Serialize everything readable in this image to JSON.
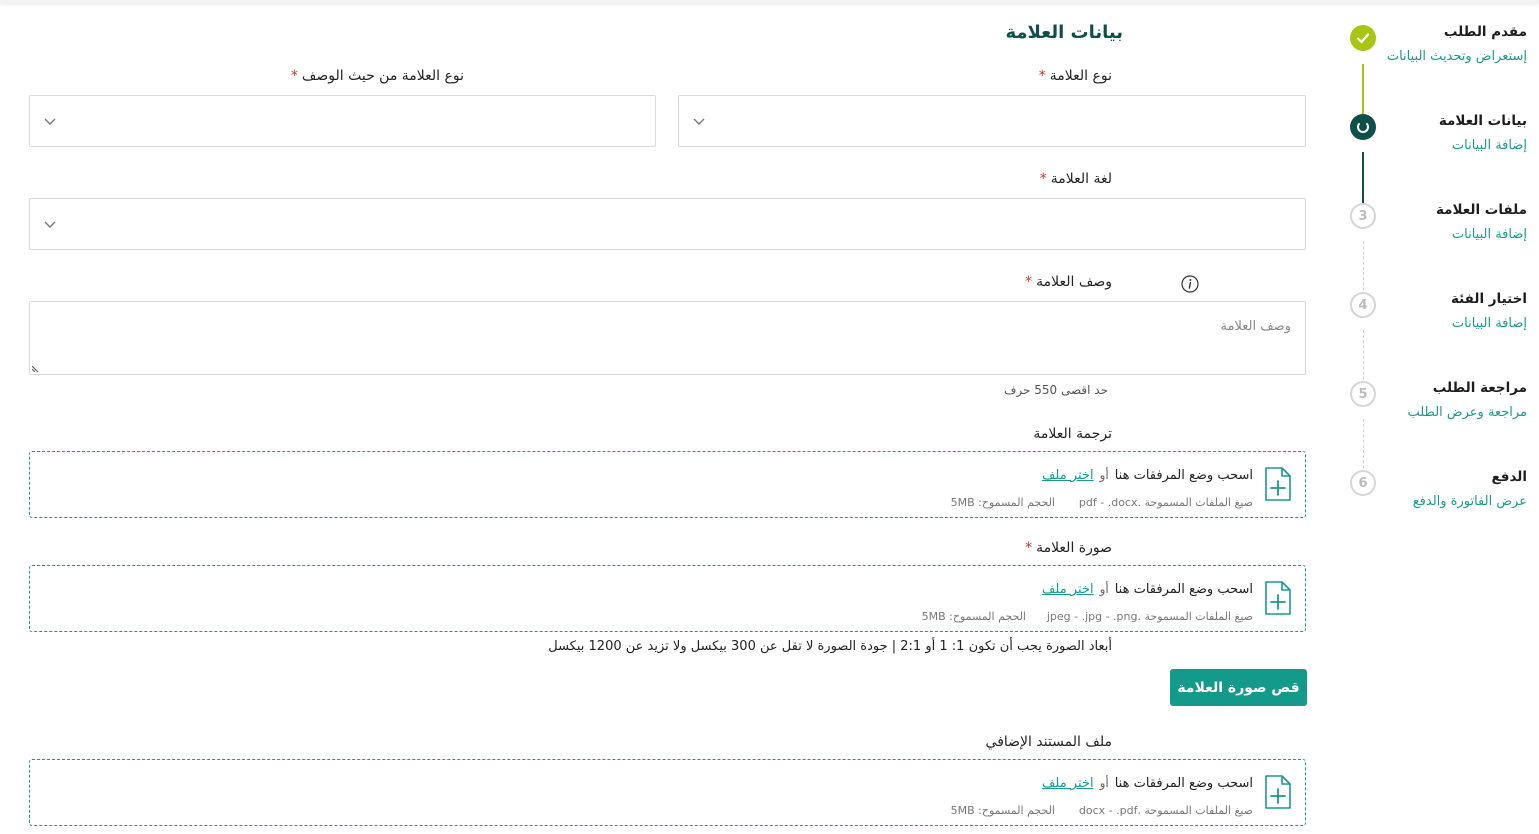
{
  "section": {
    "title": "بيانات العلامة"
  },
  "stepper": {
    "steps": [
      {
        "title": "مقدم الطلب",
        "subtitle": "إستعراض وتحديث البيانات",
        "state": "done",
        "number": ""
      },
      {
        "title": "بيانات العلامة",
        "subtitle": "إضافة البيانات",
        "state": "active",
        "number": ""
      },
      {
        "title": "ملفات العلامة",
        "subtitle": "إضافة البيانات",
        "state": "pending",
        "number": "3"
      },
      {
        "title": "اختيار الفئة",
        "subtitle": "إضافة البيانات",
        "state": "pending",
        "number": "4"
      },
      {
        "title": "مراجعة الطلب",
        "subtitle": "مراجعة وعرض الطلب",
        "state": "pending",
        "number": "5"
      },
      {
        "title": "الدفع",
        "subtitle": "عرض الفاتورة والدفع",
        "state": "pending",
        "number": "6"
      }
    ]
  },
  "fields": {
    "mark_type": {
      "label": "نوع العلامة",
      "required": "*"
    },
    "mark_desc_type": {
      "label": "نوع العلامة من حيث الوصف",
      "required": "*"
    },
    "mark_language": {
      "label": "لغة العلامة",
      "required": "*"
    },
    "mark_description": {
      "label": "وصف العلامة",
      "required": "*",
      "placeholder": "وصف العلامة",
      "limit_hint": "حد اقصى 550 حرف"
    }
  },
  "uploads": {
    "translation": {
      "label": "ترجمة العلامة",
      "drag_text": "اسحب وضع المرفقات هنا",
      "or_text": "أو",
      "choose_link": "اختر ملف",
      "formats": "صيغ الملفات المسموحة .pdf - .docx",
      "size": "الحجم المسموح: 5MB"
    },
    "image": {
      "label": "صورة العلامة",
      "required": "*",
      "drag_text": "اسحب وضع المرفقات هنا",
      "or_text": "أو",
      "choose_link": "اختر ملف",
      "formats": "صيغ الملفات المسموحة .jpeg - .jpg - .png",
      "size": "الحجم المسموح: 5MB"
    },
    "extra": {
      "label": "ملف المستند الإضافي",
      "drag_text": "اسحب وضع المرفقات هنا",
      "or_text": "أو",
      "choose_link": "اختر ملف",
      "formats": "صيغ الملفات المسموحة .docx - .pdf",
      "size": "الحجم المسموح: 5MB"
    }
  },
  "image_note": "أبعاد الصورة يجب أن تكون 1: 1 أو 2:1 | جودة الصورة لا تقل عن 300 بيكسل ولا تزيد عن 1200 بيكسل",
  "crop_button": "قص صورة العلامة",
  "colors": {
    "primary": "#149a8a",
    "dark": "#0f4f4a",
    "done": "#a9c414",
    "required": "#c0392b"
  },
  "icons": [
    "check-icon",
    "chevron-down-icon",
    "info-icon",
    "file-plus-icon"
  ]
}
